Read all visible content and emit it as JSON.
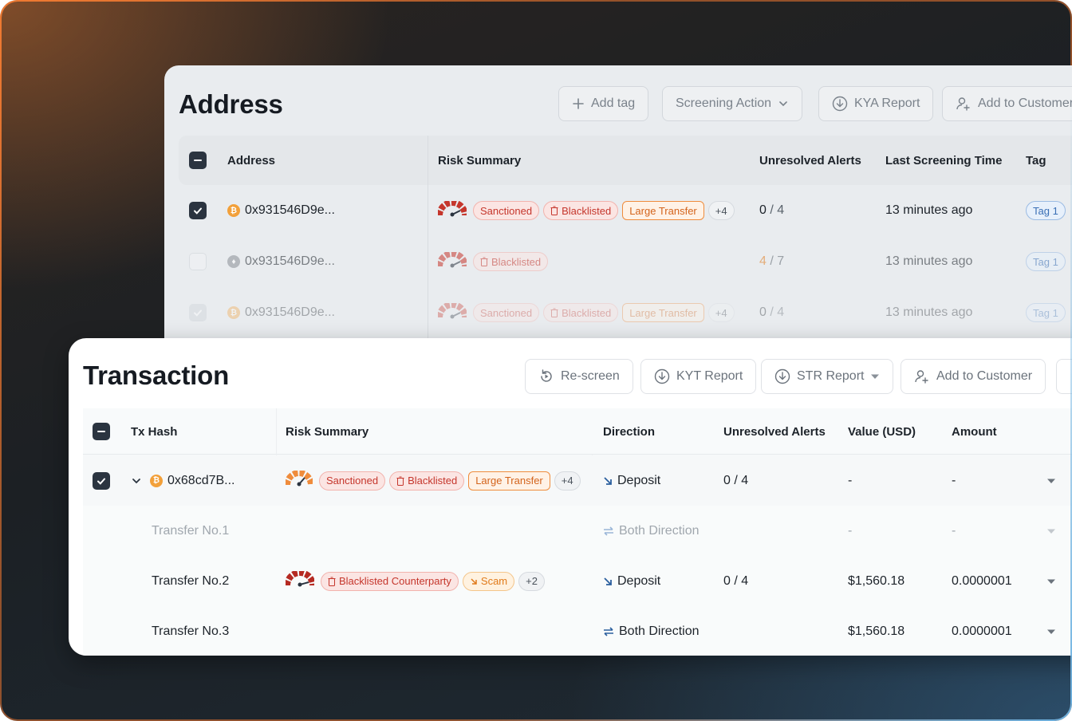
{
  "address": {
    "title": "Address",
    "toolbar": {
      "add_tag": "Add tag",
      "screening_action": "Screening Action",
      "kya_report": "KYA Report",
      "add_to_customer": "Add to Customer"
    },
    "columns": [
      "Address",
      "Risk Summary",
      "Unresolved Alerts",
      "Last Screening Time",
      "Tag"
    ],
    "rows": [
      {
        "address": "0x931546D9e...",
        "coin": "btc",
        "tags": [
          "Sanctioned",
          "Blacklisted",
          "Large Transfer"
        ],
        "more": "+4",
        "alerts_open": "0",
        "alerts_total": "/ 4",
        "time": "13 minutes ago",
        "tag": "Tag 1"
      },
      {
        "address": "0x931546D9e...",
        "coin": "eth",
        "tags": [
          "Blacklisted"
        ],
        "alerts_open": "4",
        "alerts_total": "/ 7",
        "time": "13 minutes ago",
        "tag": "Tag 1"
      },
      {
        "address": "0x931546D9e...",
        "coin": "btc",
        "tags": [
          "Sanctioned",
          "Blacklisted",
          "Large Transfer"
        ],
        "more": "+4",
        "alerts_open": "0",
        "alerts_total": "/ 4",
        "time": "13 minutes ago",
        "tag": "Tag 1"
      }
    ]
  },
  "transaction": {
    "title": "Transaction",
    "toolbar": {
      "rescreen": "Re-screen",
      "kyt_report": "KYT Report",
      "str_report": "STR Report",
      "add_to_customer": "Add to Customer"
    },
    "columns": [
      "Tx Hash",
      "Risk Summary",
      "Direction",
      "Unresolved Alerts",
      "Value (USD)",
      "Amount"
    ],
    "rows": [
      {
        "hash": "0x68cd7B...",
        "tags": [
          "Sanctioned",
          "Blacklisted",
          "Large Transfer"
        ],
        "more": "+4",
        "direction": "Deposit",
        "alerts": "0 / 4",
        "value": "-",
        "amount": "-"
      },
      {
        "hash": "Transfer No.1",
        "direction": "Both Direction",
        "value": "-",
        "amount": "-"
      },
      {
        "hash": "Transfer No.2",
        "tags": [
          "Blacklisted Counterparty",
          "Scam"
        ],
        "more": "+2",
        "direction": "Deposit",
        "alerts": "0 / 4",
        "value": "$1,560.18",
        "amount": "0.0000001"
      },
      {
        "hash": "Transfer No.3",
        "direction": "Both Direction",
        "value": "$1,560.18",
        "amount": "0.0000001"
      }
    ]
  },
  "colors": {
    "risk_red": "#c5362c",
    "accent_orange": "#ef8c3c",
    "alert_orange": "#f0a060",
    "dark": "#2b3440"
  }
}
